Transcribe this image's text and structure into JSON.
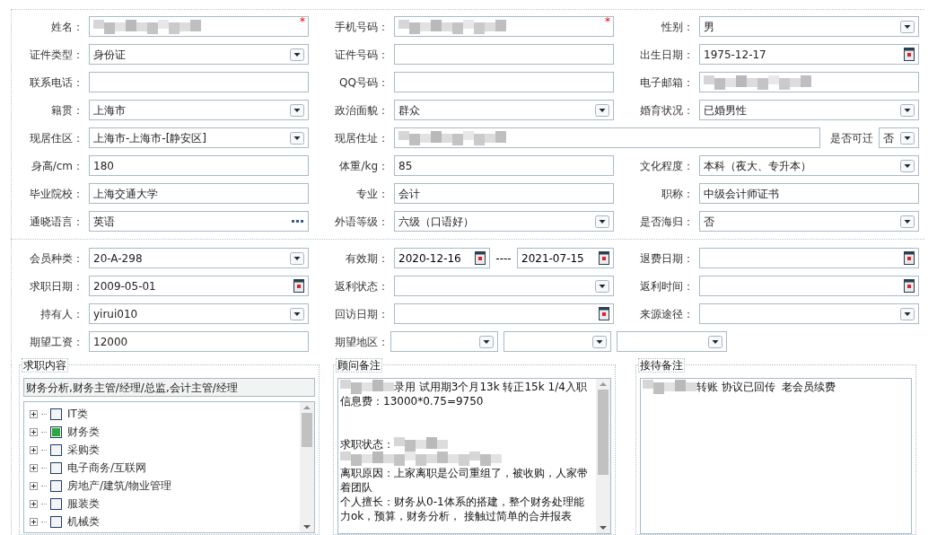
{
  "personal_rows": [
    {
      "cells": [
        {
          "label": "姓名：",
          "field": {
            "kind": "text",
            "redacted": true,
            "required_mark": "*"
          }
        },
        {
          "label": "手机号码：",
          "field": {
            "kind": "text",
            "redacted": true,
            "required_mark": "*"
          }
        },
        {
          "label": "性别：",
          "field": {
            "kind": "select",
            "value": "男"
          }
        }
      ]
    },
    {
      "cells": [
        {
          "label": "证件类型：",
          "field": {
            "kind": "select",
            "value": "身份证"
          }
        },
        {
          "label": "证件号码：",
          "field": {
            "kind": "text"
          }
        },
        {
          "label": "出生日期：",
          "field": {
            "kind": "date",
            "value": "1975-12-17"
          }
        }
      ]
    },
    {
      "cells": [
        {
          "label": "联系电话：",
          "field": {
            "kind": "text"
          }
        },
        {
          "label": "QQ号码：",
          "field": {
            "kind": "text"
          }
        },
        {
          "label": "电子邮箱：",
          "field": {
            "kind": "text",
            "redacted": true
          }
        }
      ]
    },
    {
      "cells": [
        {
          "label": "籍贯：",
          "field": {
            "kind": "select",
            "value": "上海市"
          }
        },
        {
          "label": "政治面貌：",
          "field": {
            "kind": "select",
            "value": "群众"
          }
        },
        {
          "label": "婚育状况：",
          "field": {
            "kind": "select",
            "value": "已婚男性"
          }
        }
      ]
    },
    {
      "cells": [
        {
          "label": "现居住区：",
          "field": {
            "kind": "select",
            "value": " 上海市-上海市-[静安区]"
          }
        },
        {
          "label": "现居住址：",
          "wide": true,
          "field": {
            "kind": "text",
            "redacted": true
          }
        },
        {
          "label": "是否可迁",
          "compact": true,
          "field": {
            "kind": "select",
            "value": "否"
          }
        }
      ]
    },
    {
      "cells": [
        {
          "label": "身高/cm：",
          "field": {
            "kind": "text",
            "value": "180"
          }
        },
        {
          "label": "体重/kg：",
          "field": {
            "kind": "text",
            "value": "85"
          }
        },
        {
          "label": "文化程度：",
          "field": {
            "kind": "select",
            "value": "本科（夜大、专升本）"
          }
        }
      ]
    },
    {
      "cells": [
        {
          "label": "毕业院校：",
          "field": {
            "kind": "text",
            "value": "上海交通大学"
          }
        },
        {
          "label": "专业：",
          "field": {
            "kind": "text",
            "value": "会计"
          }
        },
        {
          "label": "职称：",
          "field": {
            "kind": "text",
            "value": "中级会计师证书"
          }
        }
      ]
    },
    {
      "cells": [
        {
          "label": "通晓语言：",
          "field": {
            "kind": "lookup",
            "value": "英语"
          }
        },
        {
          "label": "外语等级：",
          "field": {
            "kind": "select",
            "value": "六级（口语好）"
          }
        },
        {
          "label": "是否海归：",
          "field": {
            "kind": "select",
            "value": "否"
          }
        }
      ]
    }
  ],
  "member_rows": [
    {
      "cells": [
        {
          "label": "会员种类：",
          "field": {
            "kind": "select",
            "value": " 20-A-298"
          }
        },
        {
          "label": "有效期：",
          "field": {
            "kind": "date_range",
            "values": [
              "2020-12-16",
              "2021-07-15"
            ],
            "separator": "----"
          }
        },
        {
          "label": "退费日期：",
          "field": {
            "kind": "date"
          }
        }
      ]
    },
    {
      "cells": [
        {
          "label": "求职日期：",
          "field": {
            "kind": "date",
            "value": "2009-05-01"
          }
        },
        {
          "label": "返利状态：",
          "field": {
            "kind": "select"
          }
        },
        {
          "label": "返利时间：",
          "field": {
            "kind": "date"
          }
        }
      ]
    },
    {
      "cells": [
        {
          "label": "持有人：",
          "field": {
            "kind": "select",
            "value": "yirui010"
          }
        },
        {
          "label": "回访日期：",
          "field": {
            "kind": "date"
          }
        },
        {
          "label": "来源途径：",
          "field": {
            "kind": "select"
          }
        }
      ]
    },
    {
      "cells": [
        {
          "label": "期望工资：",
          "field": {
            "kind": "text",
            "value": "12000"
          }
        },
        {
          "label": "期望地区：",
          "field": {
            "kind": "region_select"
          }
        }
      ]
    }
  ],
  "job_intent": {
    "legend": "求职内容",
    "summary": "财务分析,财务主管/经理/总监,会计主管/经理",
    "tree": [
      {
        "label": "IT类",
        "checked": false,
        "expanded": false
      },
      {
        "label": "财务类",
        "checked": true,
        "expanded": false
      },
      {
        "label": "采购类",
        "checked": false,
        "expanded": false
      },
      {
        "label": "电子商务/互联网",
        "checked": false,
        "expanded": false
      },
      {
        "label": "房地产/建筑/物业管理",
        "checked": false,
        "expanded": false
      },
      {
        "label": "服装类",
        "checked": false,
        "expanded": false
      },
      {
        "label": "机械类",
        "checked": false,
        "expanded": false
      }
    ]
  },
  "consultant_notes": {
    "legend": "顾问备注",
    "lines": [
      {
        "kind": "text",
        "segments": [
          {
            "kind": "redacted"
          },
          {
            "kind": "text",
            "text": "录用 试用期3个月13k 转正15k 1/4入职"
          }
        ]
      },
      {
        "kind": "text",
        "segments": [
          {
            "kind": "text",
            "text": "信息费：13000*0.75=9750"
          }
        ]
      },
      {
        "kind": "blank"
      },
      {
        "kind": "blank"
      },
      {
        "kind": "text",
        "segments": [
          {
            "kind": "text",
            "text": "求职状态："
          },
          {
            "kind": "redacted"
          }
        ]
      },
      {
        "kind": "text",
        "segments": [
          {
            "kind": "redacted"
          }
        ]
      },
      {
        "kind": "text",
        "segments": [
          {
            "kind": "text",
            "text": "离职原因：上家离职是公司重组了，被收购，人家带着团队"
          }
        ]
      },
      {
        "kind": "text",
        "segments": [
          {
            "kind": "text",
            "text": "个人擅长：财务从0-1体系的搭建，整个财务处理能力ok，预算，财务分析， 接触过简单的合并报表"
          }
        ]
      }
    ]
  },
  "reception_notes": {
    "legend": "接待备注",
    "lines": [
      {
        "kind": "text",
        "segments": [
          {
            "kind": "redacted"
          },
          {
            "kind": "text",
            "text": "转账 协议已回传  老会员续费"
          }
        ]
      }
    ]
  }
}
